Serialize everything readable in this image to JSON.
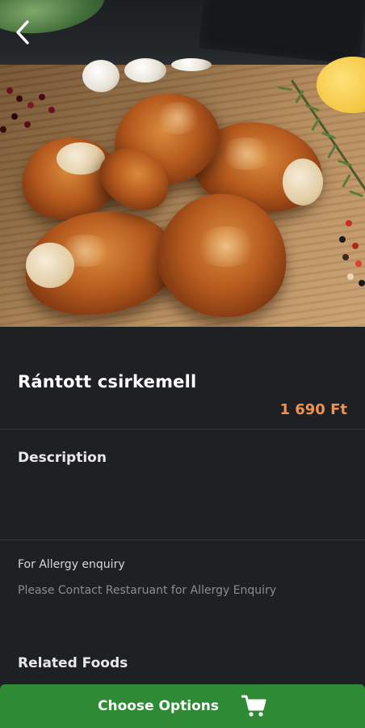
{
  "header": {
    "back_icon": "chevron-left-icon"
  },
  "food": {
    "name": "Rántott csirkemell",
    "price": "1 690 Ft"
  },
  "description": {
    "heading": "Description"
  },
  "allergy": {
    "label": "For Allergy enquiry",
    "text": "Please Contact Restaruant for Allergy Enquiry"
  },
  "related": {
    "heading": "Related Foods"
  },
  "cta": {
    "label": "Choose Options",
    "icon": "cart-icon"
  },
  "colors": {
    "background": "#1f2024",
    "price": "#f0924f",
    "cta": "#2e8a34"
  }
}
